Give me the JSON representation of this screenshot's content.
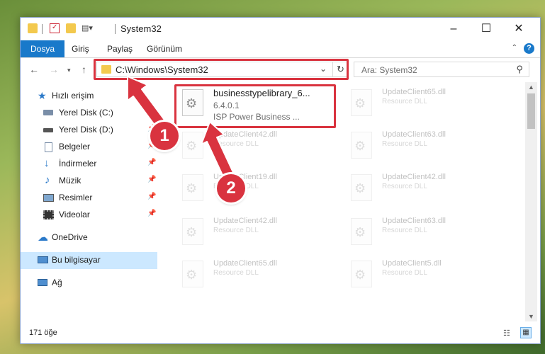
{
  "window": {
    "title": "System32",
    "controls": {
      "minimize": "–",
      "maximize": "☐",
      "close": "✕"
    }
  },
  "ribbon": {
    "tabs": [
      "Dosya",
      "Giriş",
      "Paylaş",
      "Görünüm"
    ],
    "active_tab": "Dosya",
    "help": "?"
  },
  "navbar": {
    "address": "C:\\Windows\\System32",
    "search_placeholder": "Ara: System32"
  },
  "sidebar": {
    "items": [
      {
        "label": "Hızlı erişim",
        "icon": "star-icon",
        "pinned": false
      },
      {
        "label": "Yerel Disk (C:)",
        "icon": "drive-icon",
        "pinned": true
      },
      {
        "label": "Yerel Disk (D:)",
        "icon": "drive-icon",
        "pinned": true
      },
      {
        "label": "Belgeler",
        "icon": "documents-icon",
        "pinned": true
      },
      {
        "label": "İndirmeler",
        "icon": "download-icon",
        "pinned": true
      },
      {
        "label": "Müzik",
        "icon": "music-icon",
        "pinned": true
      },
      {
        "label": "Resimler",
        "icon": "pictures-icon",
        "pinned": true
      },
      {
        "label": "Videolar",
        "icon": "video-icon",
        "pinned": true
      },
      {
        "label": "OneDrive",
        "icon": "cloud-icon",
        "pinned": false
      },
      {
        "label": "Bu bilgisayar",
        "icon": "computer-icon",
        "pinned": false,
        "selected": true
      },
      {
        "label": "Ağ",
        "icon": "network-icon",
        "pinned": false
      }
    ]
  },
  "files": [
    {
      "name": "businesstypelibrary_6...",
      "line1": "6.4.0.1",
      "line2": "ISP Power Business ...",
      "highlighted": true
    },
    {
      "name": "UpdateClient65.dll",
      "line1": "Resource DLL",
      "line2": ""
    },
    {
      "name": "UpdateClient42.dll",
      "line1": "Resource DLL",
      "line2": ""
    },
    {
      "name": "UpdateClient63.dll",
      "line1": "Resource DLL",
      "line2": ""
    },
    {
      "name": "UpdateClient19.dll",
      "line1": "Resource DLL",
      "line2": ""
    },
    {
      "name": "UpdateClient42.dll",
      "line1": "Resource DLL",
      "line2": ""
    },
    {
      "name": "UpdateClient42.dll",
      "line1": "Resource DLL",
      "line2": ""
    },
    {
      "name": "UpdateClient63.dll",
      "line1": "Resource DLL",
      "line2": ""
    },
    {
      "name": "UpdateClient65.dll",
      "line1": "Resource DLL",
      "line2": ""
    },
    {
      "name": "UpdateClient5.dll",
      "line1": "Resource DLL",
      "line2": ""
    }
  ],
  "status": {
    "item_count": "171 öğe"
  },
  "annotations": {
    "step1": "1",
    "step2": "2",
    "color": "#d9333f"
  }
}
